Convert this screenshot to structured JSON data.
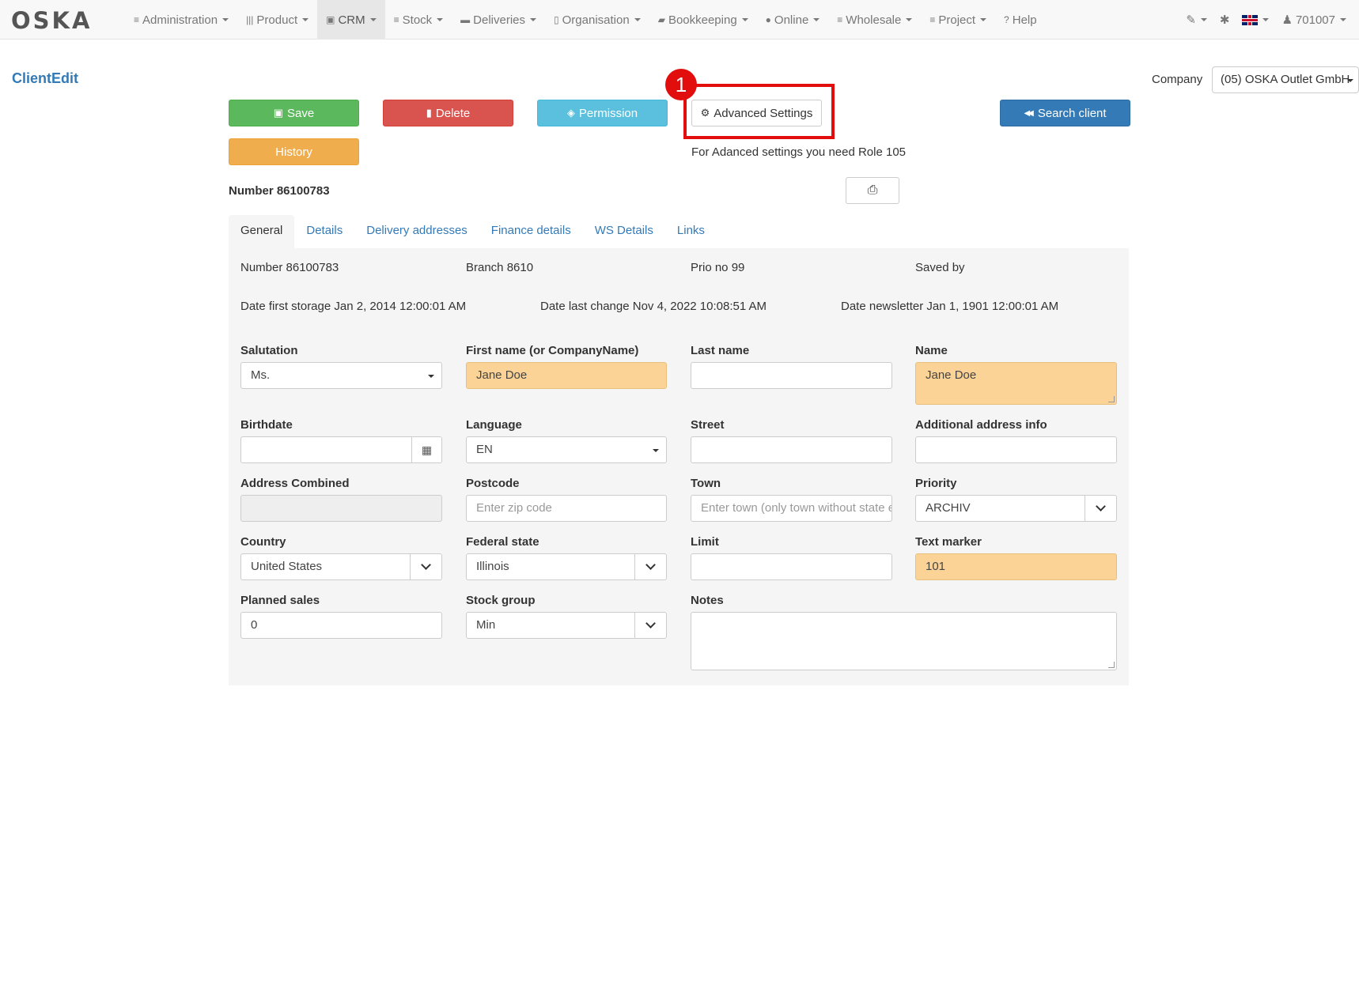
{
  "brand": "OSKA",
  "nav": {
    "items": [
      {
        "icon": "≡",
        "label": "Administration"
      },
      {
        "icon": "|||",
        "label": "Product"
      },
      {
        "icon": "▣",
        "label": "CRM"
      },
      {
        "icon": "≡",
        "label": "Stock"
      },
      {
        "icon": "▬",
        "label": "Deliveries"
      },
      {
        "icon": "▯",
        "label": "Organisation"
      },
      {
        "icon": "▰",
        "label": "Bookkeeping"
      },
      {
        "icon": "●",
        "label": "Online"
      },
      {
        "icon": "≡",
        "label": "Wholesale"
      },
      {
        "icon": "≡",
        "label": "Project"
      },
      {
        "icon": "?",
        "label": "Help"
      }
    ],
    "active": "CRM",
    "user": "701007",
    "tools_icon": "✎",
    "bug_icon": "✱",
    "user_icon": "♟"
  },
  "page": {
    "title": "ClientEdit",
    "company_label": "Company",
    "company_value": "(05) OSKA Outlet GmbH"
  },
  "buttons": {
    "save": "Save",
    "delete": "Delete",
    "permission": "Permission",
    "advanced": "Advanced Settings",
    "search": "Search client",
    "history": "History",
    "save_icon": "▣",
    "delete_icon": "▮",
    "permission_icon": "◈",
    "advanced_icon": "⚙",
    "search_icon": "◀◀",
    "print_icon": "⎙"
  },
  "annotation": {
    "step": "1",
    "color": "#e20e0e"
  },
  "role_note": "For Adanced settings you need Role 105",
  "client_number": "Number 86100783",
  "tabs": [
    "General",
    "Details",
    "Delivery addresses",
    "Finance details",
    "WS Details",
    "Links"
  ],
  "info": {
    "number": "Number 86100783",
    "branch": "Branch 8610",
    "prio": "Prio no 99",
    "saved_by": "Saved by",
    "date_first": "Date first storage Jan 2, 2014 12:00:01 AM",
    "date_change": "Date last change Nov 4, 2022 10:08:51 AM",
    "date_news": "Date newsletter Jan 1, 1901 12:00:01 AM"
  },
  "form": {
    "salutation": {
      "label": "Salutation",
      "value": "Ms."
    },
    "first_name": {
      "label": "First name (or CompanyName)",
      "value": "Jane Doe"
    },
    "last_name": {
      "label": "Last name",
      "value": ""
    },
    "name": {
      "label": "Name",
      "value": "Jane Doe"
    },
    "birthdate": {
      "label": "Birthdate",
      "value": "",
      "icon": "▦"
    },
    "language": {
      "label": "Language",
      "value": "EN"
    },
    "street": {
      "label": "Street",
      "value": ""
    },
    "additional": {
      "label": "Additional address info",
      "value": ""
    },
    "address_combined": {
      "label": "Address Combined",
      "value": ""
    },
    "postcode": {
      "label": "Postcode",
      "placeholder": "Enter zip code"
    },
    "town": {
      "label": "Town",
      "placeholder": "Enter town (only town without state e"
    },
    "priority": {
      "label": "Priority",
      "value": "ARCHIV"
    },
    "country": {
      "label": "Country",
      "value": "United States"
    },
    "federal_state": {
      "label": "Federal state",
      "value": "Illinois"
    },
    "limit": {
      "label": "Limit",
      "value": ""
    },
    "text_marker": {
      "label": "Text marker",
      "value": "101"
    },
    "planned_sales": {
      "label": "Planned sales",
      "value": "0"
    },
    "stock_group": {
      "label": "Stock group",
      "value": "Min"
    },
    "notes": {
      "label": "Notes",
      "value": ""
    }
  }
}
